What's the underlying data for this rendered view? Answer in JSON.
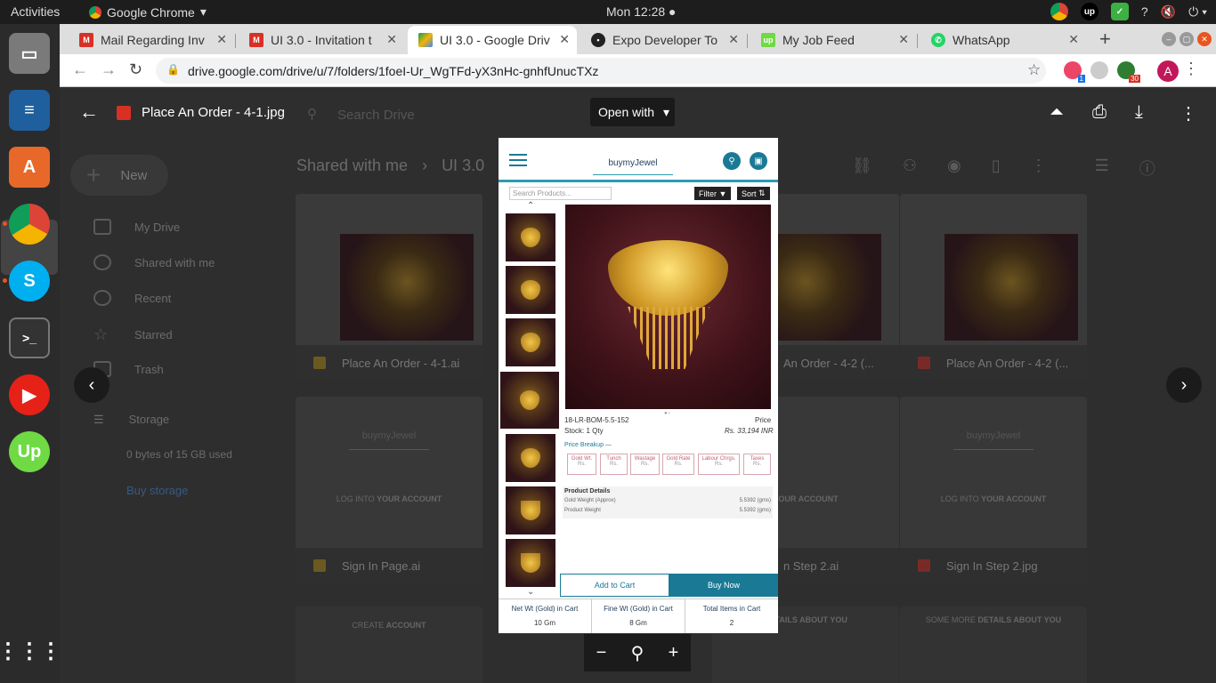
{
  "system": {
    "activities": "Activities",
    "app_name": "Google Chrome",
    "clock": "Mon 12:28"
  },
  "tabs": [
    {
      "title": "Mail Regarding Inv",
      "favicon": "gmail-icon"
    },
    {
      "title": "UI 3.0 - Invitation t",
      "favicon": "gmail-icon"
    },
    {
      "title": "UI 3.0 - Google Driv",
      "favicon": "drive-icon",
      "active": true
    },
    {
      "title": "Expo Developer To",
      "favicon": "expo-icon"
    },
    {
      "title": "My Job Feed",
      "favicon": "upwork-icon"
    },
    {
      "title": "WhatsApp",
      "favicon": "whatsapp-icon"
    }
  ],
  "omnibox": {
    "url": "drive.google.com/drive/u/7/folders/1foeI-Ur_WgTFd-yX3nHc-gnhfUnucTXz",
    "ext_badge_1": "1",
    "ext_badge_2": "30",
    "avatar_letter": "A"
  },
  "drive": {
    "search_placeholder": "Search Drive",
    "new_label": "New",
    "breadcrumb_root": "Shared with me",
    "breadcrumb_folder": "UI 3.0",
    "sidebar": [
      "My Drive",
      "Shared with me",
      "Recent",
      "Starred",
      "Trash"
    ],
    "storage_label": "Storage",
    "storage_used": "0 bytes of 15 GB used",
    "buy_storage": "Buy storage",
    "files": [
      {
        "name": "Place An Order - 4-1.ai"
      },
      {
        "name": "An Order - 4-2 (..."
      },
      {
        "name": "Place An Order - 4-2 (..."
      },
      {
        "name": "Sign In Page.ai"
      },
      {
        "name": "n Step 2.ai"
      },
      {
        "name": "Sign In Step 2.jpg"
      }
    ],
    "login_text": "LOG INTO",
    "login_bold": "YOUR ACCOUNT",
    "create_text": "CREATE",
    "create_bold": "ACCOUNT",
    "details_text": "SOME MORE",
    "details_bold": "DETAILS ABOUT YOU"
  },
  "viewer": {
    "file_title": "Place An Order - 4-1.jpg",
    "open_with": "Open with"
  },
  "photo": {
    "logo": "buymyJewel",
    "search_placeholder": "Search Products...",
    "filter": "Filter",
    "sort": "Sort",
    "sku": "18-LR-BOM-5.5-152",
    "price_label": "Price",
    "stock": "Stock: 1 Qty",
    "price": "Rs. 33,194 INR",
    "price_breakup": "Price Breakup —",
    "breakup_cols": [
      "Gold Wt.",
      "Tunch",
      "Wastage",
      "Gold Rate",
      "Labour Chrgs.",
      "Taxes"
    ],
    "breakup_val": "Rs.",
    "details_title": "Product Details",
    "gold_weight_label": "Gold Weight (Approx)",
    "gold_weight_value": "5.5392 (gms)",
    "product_weight_label": "Product Weight",
    "product_weight_value": "5.5392 (gms)",
    "add_to_cart": "Add to Cart",
    "buy_now": "Buy Now",
    "footer": [
      {
        "label": "Net Wt (Gold) in Cart",
        "value": "10 Gm"
      },
      {
        "label": "Fine Wt (Gold) in Cart",
        "value": "8 Gm"
      },
      {
        "label": "Total Items in Cart",
        "value": "2"
      }
    ]
  }
}
